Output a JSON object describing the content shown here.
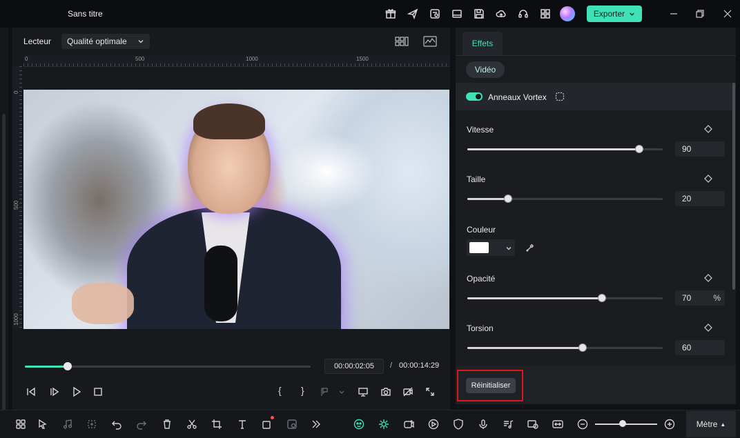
{
  "app": {
    "title": "Sans titre",
    "export_label": "Exporter"
  },
  "titlebar_icons": [
    "gift-icon",
    "send-icon",
    "project-icon",
    "layout-icon",
    "save-icon",
    "cloud-upload-icon",
    "headset-icon",
    "grid-icon"
  ],
  "player": {
    "label": "Lecteur",
    "quality": "Qualité optimale",
    "ruler_top": [
      "0",
      "500",
      "1000",
      "1500"
    ],
    "ruler_left": [
      "0",
      "500",
      "1000"
    ],
    "time_current": "00:00:02:05",
    "time_separator": "/",
    "time_total": "00:00:14:29",
    "progress": 0.15
  },
  "effects_panel": {
    "tab": "Effets",
    "subtab": "Vidéo",
    "effect_name": "Anneaux Vortex",
    "effect_enabled": true,
    "params": {
      "speed": {
        "label": "Vitesse",
        "value": "90",
        "fraction": 0.88
      },
      "size": {
        "label": "Taille",
        "value": "20",
        "fraction": 0.21
      },
      "color": {
        "label": "Couleur",
        "value": "#ffffff"
      },
      "opacity": {
        "label": "Opacité",
        "value": "70",
        "unit": "%",
        "fraction": 0.69
      },
      "twist": {
        "label": "Torsion",
        "value": "60",
        "fraction": 0.59
      }
    },
    "reset_label": "Réinitialiser"
  },
  "bottom_toolbar": {
    "ruler_unit": "Mètre",
    "caret": "▲"
  },
  "colors": {
    "accent": "#3ee2b6",
    "highlight": "#e1141b"
  }
}
